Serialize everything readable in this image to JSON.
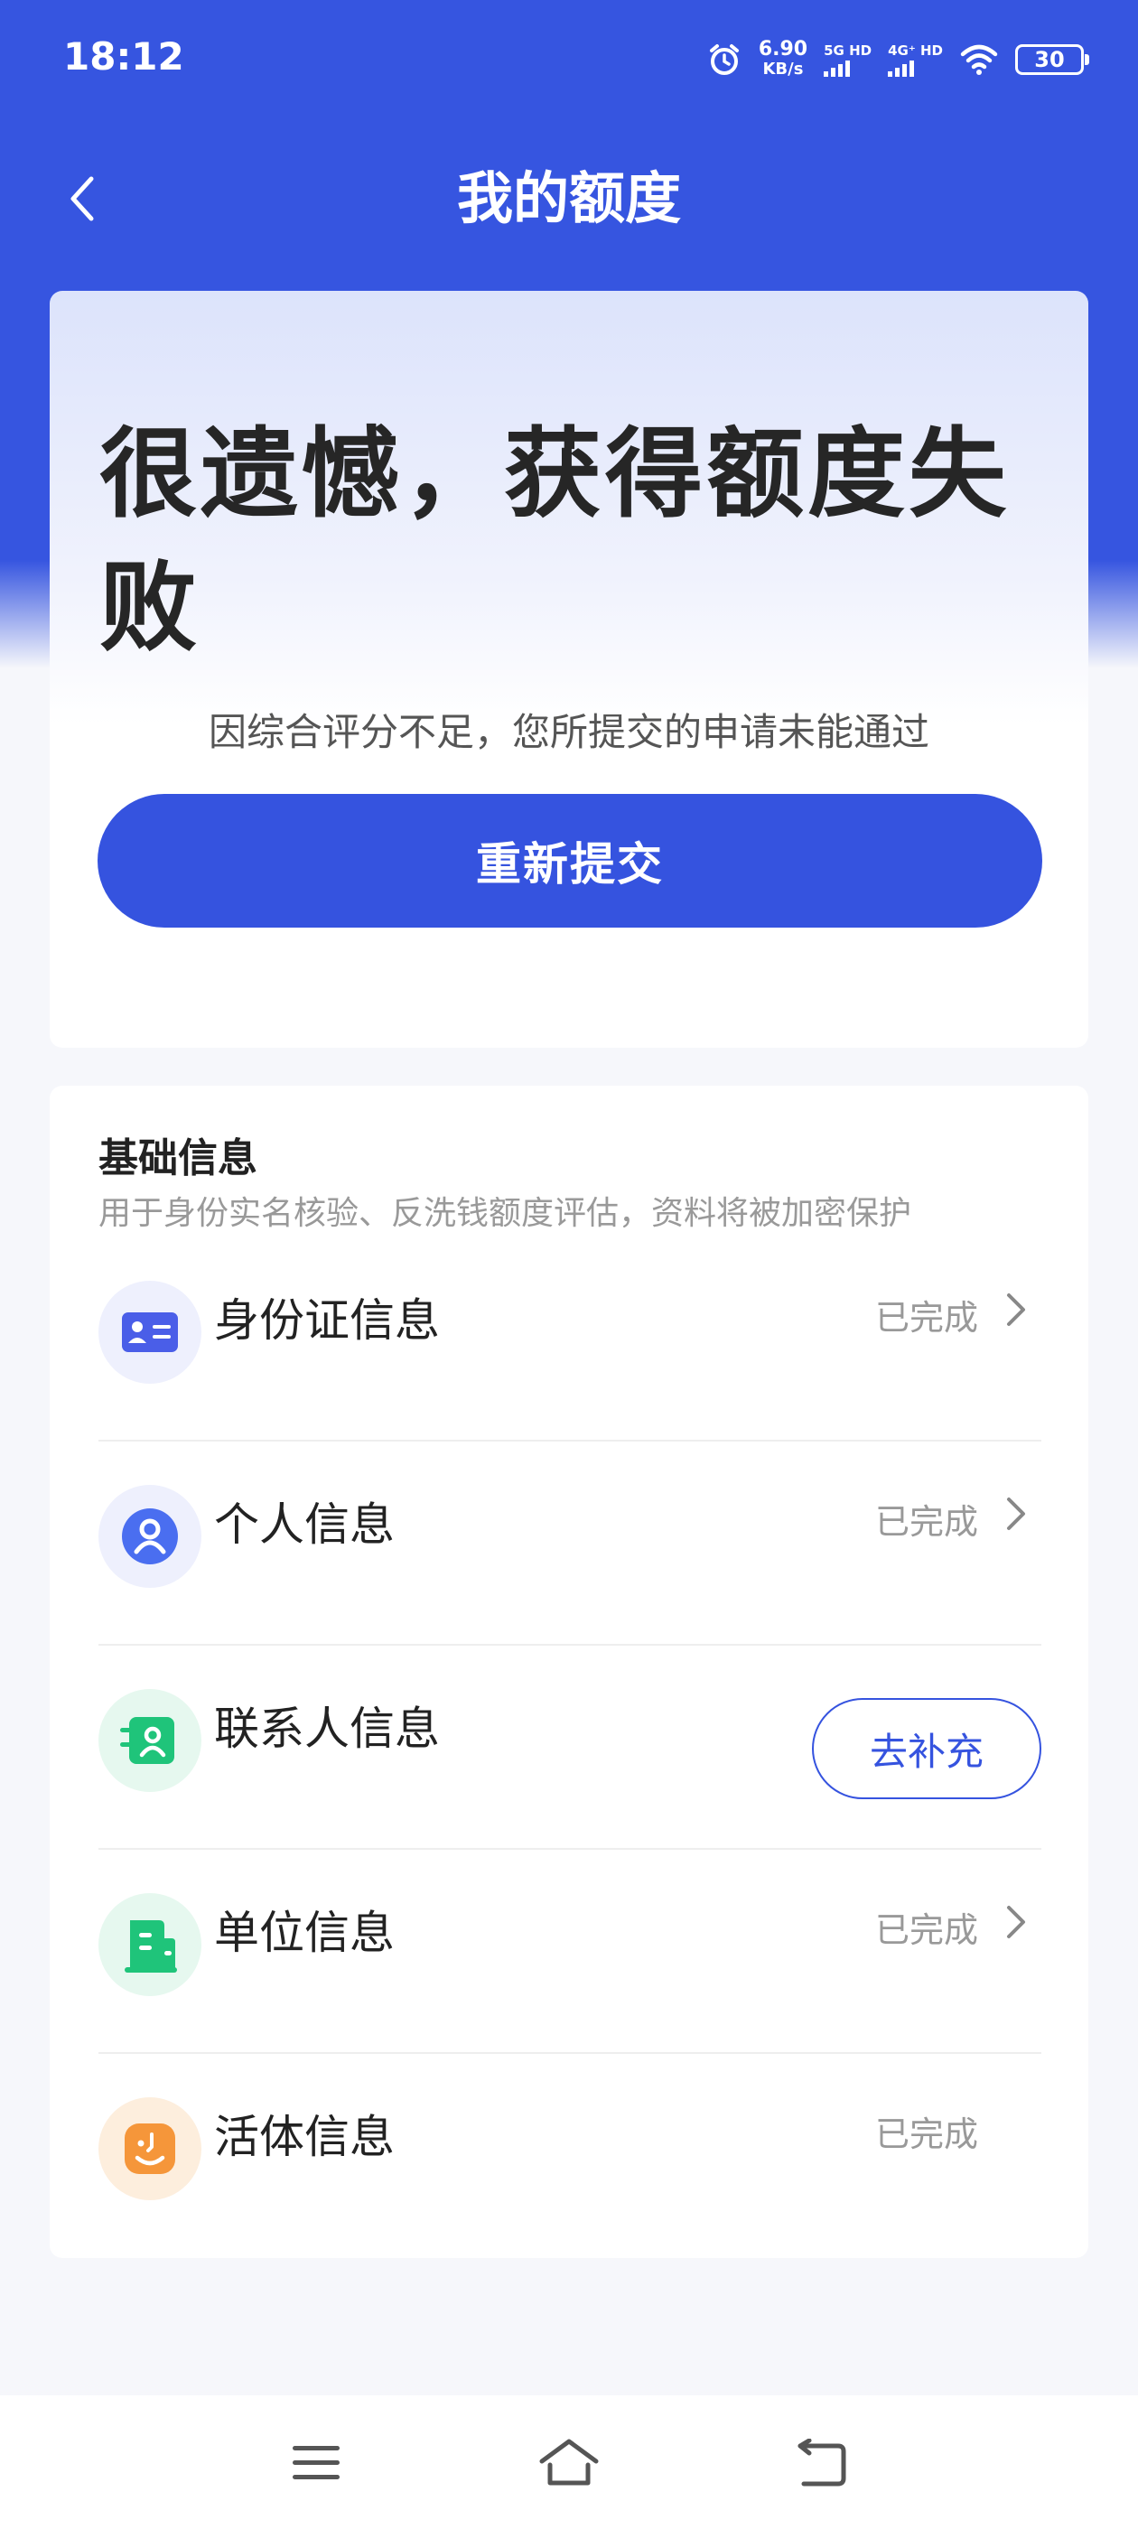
{
  "status_bar": {
    "time": "18:12",
    "speed_value": "6.90",
    "speed_unit": "KB/s",
    "net1_label": "5G HD",
    "net2_label": "4G⁺ HD",
    "battery": "30"
  },
  "header": {
    "title": "我的额度",
    "back_icon": "chevron-left-icon"
  },
  "result": {
    "title": "很遗憾，获得额度失败",
    "description": "因综合评分不足，您所提交的申请未能通过",
    "resubmit_label": "重新提交"
  },
  "basic_info": {
    "title": "基础信息",
    "subtitle": "用于身份实名核验、反洗钱额度评估，资料将被加密保护",
    "items": [
      {
        "label": "身份证信息",
        "status": "已完成",
        "icon": "id-card-icon",
        "accent": "#4a5ee8"
      },
      {
        "label": "个人信息",
        "status": "已完成",
        "icon": "person-icon",
        "accent": "#4a6ef0"
      },
      {
        "label": "联系人信息",
        "action": "去补充",
        "icon": "contacts-icon",
        "accent": "#1fc47a"
      },
      {
        "label": "单位信息",
        "status": "已完成",
        "icon": "building-icon",
        "accent": "#1fc47a"
      },
      {
        "label": "活体信息",
        "status": "已完成",
        "icon": "face-icon",
        "accent": "#f5963a"
      }
    ]
  },
  "colors": {
    "primary": "#3553df",
    "header_bg": "#3655e0",
    "page_bg": "#f6f7fb"
  }
}
